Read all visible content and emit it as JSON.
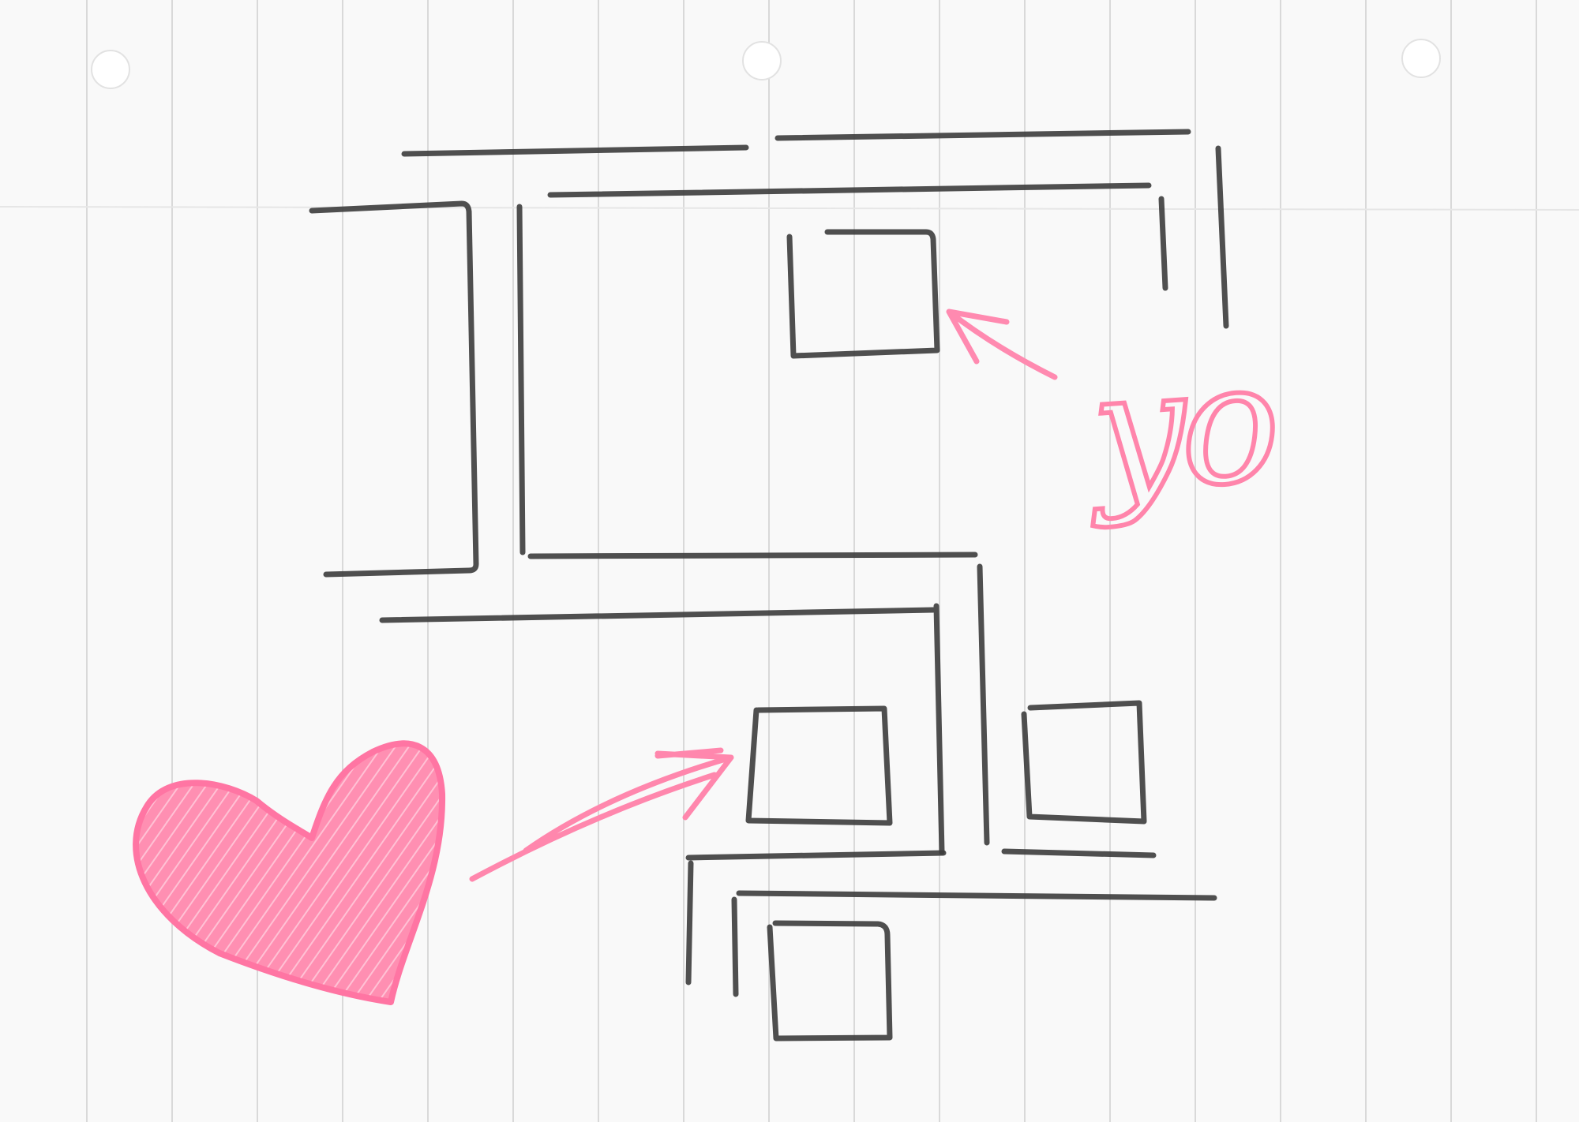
{
  "annotation": {
    "text": "yo"
  },
  "colors": {
    "paper": "#f9f9f9",
    "paper_lines": "#d9d9d9",
    "pencil": "#3c3c3c",
    "highlight": "#ff85ab"
  },
  "icons": {
    "heart": "heart-icon",
    "arrow": "arrow-icon"
  }
}
